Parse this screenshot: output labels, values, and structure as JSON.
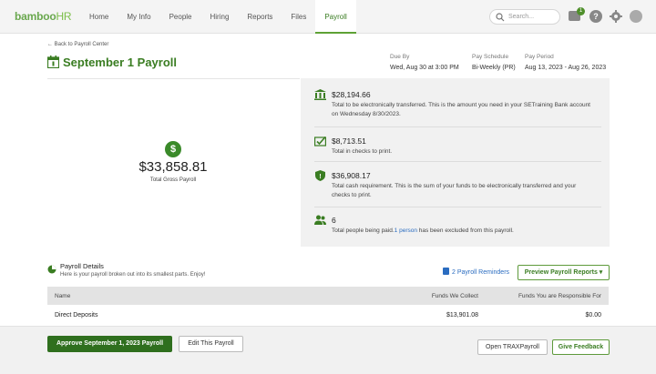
{
  "header": {
    "logo_main": "bamboo",
    "logo_sub": "HR",
    "nav": [
      "Home",
      "My Info",
      "People",
      "Hiring",
      "Reports",
      "Files",
      "Payroll"
    ],
    "search_placeholder": "Search...",
    "inbox_count": "1",
    "help_glyph": "?"
  },
  "page": {
    "back_link": "Back to Payroll Center",
    "title": "September 1 Payroll",
    "meta": [
      {
        "label": "Due By",
        "value": "Wed, Aug 30 at 3:00 PM"
      },
      {
        "label": "Pay Schedule",
        "value": "Bi-Weekly (PR)"
      },
      {
        "label": "Pay Period",
        "value": "Aug 13, 2023 - Aug 26, 2023"
      }
    ]
  },
  "summary": {
    "gross_amount": "$33,858.81",
    "gross_label": "Total Gross Payroll",
    "items": [
      {
        "amount": "$28,194.66",
        "desc": "Total to be electronically transferred. This is the amount you need in your SETraining Bank account on Wednesday 8/30/2023."
      },
      {
        "amount": "$8,713.51",
        "desc": "Total in checks to print."
      },
      {
        "amount": "$36,908.17",
        "desc": "Total cash requirement. This is the sum of your funds to be electronically transferred and your checks to print."
      },
      {
        "amount": "6",
        "desc_pre": "Total people being paid.",
        "desc_link": "1 person",
        "desc_post": " has been excluded from this payroll."
      }
    ]
  },
  "details": {
    "title": "Payroll Details",
    "subtitle": "Here is your payroll broken out into its smallest parts. Enjoy!",
    "reminders": "2 Payroll Reminders",
    "preview_button": "Preview Payroll Reports",
    "columns": [
      "Name",
      "Funds We Collect",
      "Funds You are Responsible For"
    ],
    "rows": [
      {
        "name": "Direct Deposits",
        "collect": "$13,901.08",
        "responsible": "$0.00"
      }
    ]
  },
  "footer": {
    "approve": "Approve September 1, 2023 Payroll",
    "edit": "Edit This Payroll",
    "trax": "Open TRAXPayroll",
    "feedback": "Give Feedback"
  },
  "colors": {
    "brand_green": "#3a7d22",
    "link_blue": "#2a6cc0",
    "primary_button": "#2f6f1e"
  }
}
